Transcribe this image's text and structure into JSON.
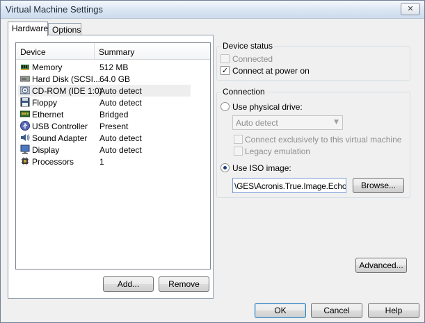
{
  "window": {
    "title": "Virtual Machine Settings"
  },
  "tabs": [
    {
      "label": "Hardware",
      "active": true
    },
    {
      "label": "Options",
      "active": false
    }
  ],
  "device_list": {
    "columns": [
      "Device",
      "Summary"
    ],
    "rows": [
      {
        "device": "Memory",
        "summary": "512 MB",
        "icon": "memory-icon"
      },
      {
        "device": "Hard Disk (SCSI...",
        "summary": "64.0 GB",
        "icon": "hard-disk-icon"
      },
      {
        "device": "CD-ROM (IDE 1:0)",
        "summary": "Auto detect",
        "icon": "cdrom-icon",
        "selected": true
      },
      {
        "device": "Floppy",
        "summary": "Auto detect",
        "icon": "floppy-icon"
      },
      {
        "device": "Ethernet",
        "summary": "Bridged",
        "icon": "ethernet-icon"
      },
      {
        "device": "USB Controller",
        "summary": "Present",
        "icon": "usb-icon"
      },
      {
        "device": "Sound Adapter",
        "summary": "Auto detect",
        "icon": "sound-icon"
      },
      {
        "device": "Display",
        "summary": "Auto detect",
        "icon": "display-icon"
      },
      {
        "device": "Processors",
        "summary": "1",
        "icon": "processor-icon"
      }
    ]
  },
  "list_buttons": {
    "add": "Add...",
    "remove": "Remove"
  },
  "device_status": {
    "legend": "Device status",
    "connected": {
      "label": "Connected",
      "checked": false,
      "enabled": false
    },
    "connect_at_power_on": {
      "label": "Connect at power on",
      "checked": true,
      "enabled": true
    }
  },
  "connection": {
    "legend": "Connection",
    "use_physical_drive": {
      "label": "Use physical drive:",
      "selected": false
    },
    "drive_select": {
      "value": "Auto detect",
      "enabled": false
    },
    "connect_exclusively": {
      "label": "Connect exclusively to this virtual machine",
      "checked": false,
      "enabled": false
    },
    "legacy_emulation": {
      "label": "Legacy emulation",
      "checked": false,
      "enabled": false
    },
    "use_iso_image": {
      "label": "Use ISO image:",
      "selected": true
    },
    "iso_path": "\\GES\\Acronis.True.Image.Echo.S",
    "browse": "Browse..."
  },
  "advanced_button": "Advanced...",
  "footer": {
    "ok": "OK",
    "cancel": "Cancel",
    "help": "Help"
  },
  "icons": {
    "close": "close-icon"
  },
  "colors": {
    "selection": "#eeeeee",
    "default_button_border": "#3c7fb1"
  }
}
